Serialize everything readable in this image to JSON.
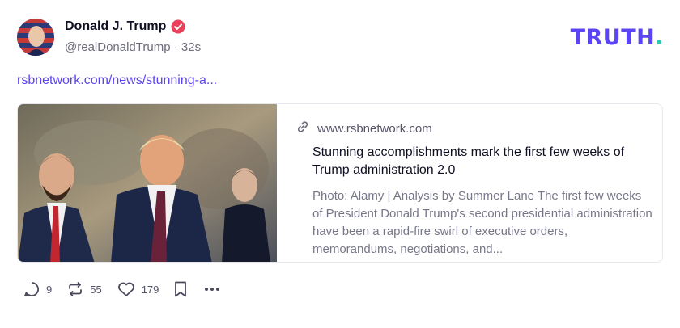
{
  "post": {
    "display_name": "Donald J. Trump",
    "handle": "@realDonaldTrump",
    "separator": "·",
    "time_ago": "32s",
    "link_text": "rsbnetwork.com/news/stunning-a..."
  },
  "brand": {
    "logo_text": "TRUTH",
    "logo_dot": ".",
    "primary_color": "#5b44f2",
    "accent_color": "#2fc6b4"
  },
  "card": {
    "domain": "www.rsbnetwork.com",
    "title": "Stunning accomplishments mark the first few weeks of Trump administration 2.0",
    "description": "Photo: Alamy | Analysis by Summer Lane The first few weeks of President Donald Trump's second presidential administration have been a rapid-fire swirl of executive orders, memorandums, negotiations, and..."
  },
  "actions": {
    "replies": "9",
    "retruths": "55",
    "likes": "179"
  },
  "icons": {
    "verified": "verified-badge-icon",
    "link": "link-icon",
    "reply": "reply-icon",
    "retruth": "retruth-icon",
    "like": "heart-icon",
    "bookmark": "bookmark-icon",
    "more": "more-icon"
  }
}
